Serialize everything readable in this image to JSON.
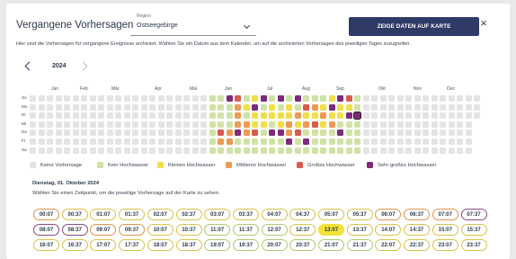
{
  "dialog": {
    "title": "Vergangene Vorhersagen",
    "region_label": "Region",
    "region_value": "Ostseegebirge",
    "map_button": "ZEIGE DATEN AUF KARTE",
    "close_icon": "close-icon",
    "description": "Hier sind die Vorhersagen für vergangene Ereignisse archiviert. Wählen Sie ein Datum aus dem Kalender, um auf die archivierten Vorhersagen des jeweiligen Tages zuzugreifen."
  },
  "calendar": {
    "year": "2024",
    "prev_icon": "chevron-left-icon",
    "next_icon": "chevron-right-icon",
    "months": [
      "Jan",
      "Feb",
      "Mär",
      "Apr",
      "Mai",
      "Jun",
      "Jul",
      "Aug",
      "Sep",
      "Okt",
      "Nov",
      "Dez"
    ],
    "weekdays": [
      "So",
      "Mo",
      "Di",
      "Mi",
      "Do",
      "Fr",
      "Sa"
    ],
    "colors": {
      "none": "#e4e4e4",
      "kein": "#cfe3a6",
      "klein": "#f1de4a",
      "mittel": "#ec9a54",
      "gross": "#db5a4e",
      "sehr": "#7d2a78"
    },
    "levels": {
      "mittel": [
        [
          22,
          5
        ],
        [
          23,
          4
        ],
        [
          23,
          5
        ],
        [
          24,
          1
        ],
        [
          24,
          2
        ],
        [
          24,
          3
        ],
        [
          25,
          3
        ],
        [
          25,
          4
        ],
        [
          30,
          3
        ],
        [
          30,
          4
        ],
        [
          31,
          2
        ],
        [
          32,
          3
        ],
        [
          33,
          1
        ],
        [
          34,
          2
        ],
        [
          35,
          3
        ]
      ],
      "gross": [
        [
          22,
          4
        ],
        [
          24,
          0
        ],
        [
          26,
          4
        ],
        [
          31,
          4
        ],
        [
          32,
          1
        ],
        [
          33,
          3
        ],
        [
          37,
          0
        ]
      ],
      "sehr": [
        [
          23,
          0
        ],
        [
          24,
          4
        ],
        [
          26,
          1
        ],
        [
          27,
          0
        ],
        [
          28,
          4
        ],
        [
          29,
          0
        ],
        [
          29,
          4
        ],
        [
          30,
          5
        ],
        [
          31,
          0
        ],
        [
          32,
          5
        ],
        [
          35,
          1
        ],
        [
          36,
          0
        ],
        [
          36,
          4
        ],
        [
          37,
          2
        ]
      ],
      "klein": [
        [
          25,
          1
        ],
        [
          26,
          0
        ],
        [
          26,
          2
        ],
        [
          26,
          3
        ],
        [
          27,
          2
        ],
        [
          27,
          3
        ],
        [
          28,
          1
        ],
        [
          28,
          2
        ],
        [
          29,
          2
        ],
        [
          29,
          3
        ],
        [
          30,
          1
        ],
        [
          30,
          2
        ],
        [
          31,
          3
        ],
        [
          32,
          2
        ],
        [
          33,
          2
        ],
        [
          34,
          1
        ],
        [
          34,
          3
        ],
        [
          35,
          0
        ],
        [
          35,
          2
        ],
        [
          36,
          1
        ],
        [
          36,
          2
        ],
        [
          37,
          1
        ]
      ],
      "kein_ranges": [
        [
          21,
          38
        ]
      ]
    },
    "selected": [
      38,
      2
    ]
  },
  "legend": [
    {
      "label": "Keine Vorhersage",
      "color": "#e4e4e4"
    },
    {
      "label": "Kein Hochwasser",
      "color": "#cfe3a6"
    },
    {
      "label": "Kleines Hochwasser",
      "color": "#f1de4a"
    },
    {
      "label": "Mittleres Hochwasser",
      "color": "#ec9a54"
    },
    {
      "label": "Großes Hochwasser",
      "color": "#db5a4e"
    },
    {
      "label": "Sehr großes Hochwasser",
      "color": "#7d2a78"
    }
  ],
  "detail": {
    "date": "Dienstag, 01. Oktober 2024",
    "hint": "Wählen Sie einen Zeitpunkt, um die jeweilige Vorhersage auf der Karte zu sehen."
  },
  "times": [
    {
      "label": "00:07",
      "level": "mittel"
    },
    {
      "label": "00:37",
      "level": "klein"
    },
    {
      "label": "01:07",
      "level": "klein"
    },
    {
      "label": "01:37",
      "level": "klein"
    },
    {
      "label": "02:07",
      "level": "klein"
    },
    {
      "label": "02:37",
      "level": "klein"
    },
    {
      "label": "03:07",
      "level": "klein"
    },
    {
      "label": "03:37",
      "level": "klein"
    },
    {
      "label": "04:07",
      "level": "klein"
    },
    {
      "label": "04:37",
      "level": "klein"
    },
    {
      "label": "05:07",
      "level": "klein"
    },
    {
      "label": "05:37",
      "level": "klein"
    },
    {
      "label": "06:07",
      "level": "mittel"
    },
    {
      "label": "06:37",
      "level": "mittel"
    },
    {
      "label": "07:07",
      "level": "mittel"
    },
    {
      "label": "07:37",
      "level": "sehr"
    },
    {
      "label": "08:07",
      "level": "sehr"
    },
    {
      "label": "08:37",
      "level": "sehr"
    },
    {
      "label": "09:07",
      "level": "mittel"
    },
    {
      "label": "09:37",
      "level": "mittel"
    },
    {
      "label": "10:07",
      "level": "klein"
    },
    {
      "label": "10:37",
      "level": "klein"
    },
    {
      "label": "11:07",
      "level": "kein"
    },
    {
      "label": "11:37",
      "level": "kein"
    },
    {
      "label": "12:07",
      "level": "kein"
    },
    {
      "label": "12:37",
      "level": "klein"
    },
    {
      "label": "13:07",
      "level": "klein",
      "selected": true
    },
    {
      "label": "13:37",
      "level": "klein"
    },
    {
      "label": "14:07",
      "level": "klein"
    },
    {
      "label": "14:37",
      "level": "klein"
    },
    {
      "label": "15:07",
      "level": "klein"
    },
    {
      "label": "15:37",
      "level": "klein"
    },
    {
      "label": "16:07",
      "level": "klein"
    },
    {
      "label": "16:37",
      "level": "klein"
    },
    {
      "label": "17:07",
      "level": "klein"
    },
    {
      "label": "17:37",
      "level": "klein"
    },
    {
      "label": "18:07",
      "level": "klein"
    },
    {
      "label": "18:37",
      "level": "klein"
    },
    {
      "label": "19:07",
      "level": "kein"
    },
    {
      "label": "19:37",
      "level": "kein"
    },
    {
      "label": "20:07",
      "level": "kein"
    },
    {
      "label": "20:37",
      "level": "kein"
    },
    {
      "label": "21:07",
      "level": "kein"
    },
    {
      "label": "21:37",
      "level": "kein"
    },
    {
      "label": "22:07",
      "level": "klein"
    },
    {
      "label": "22:37",
      "level": "klein"
    },
    {
      "label": "23:07",
      "level": "klein"
    },
    {
      "label": "23:37",
      "level": "klein"
    }
  ]
}
